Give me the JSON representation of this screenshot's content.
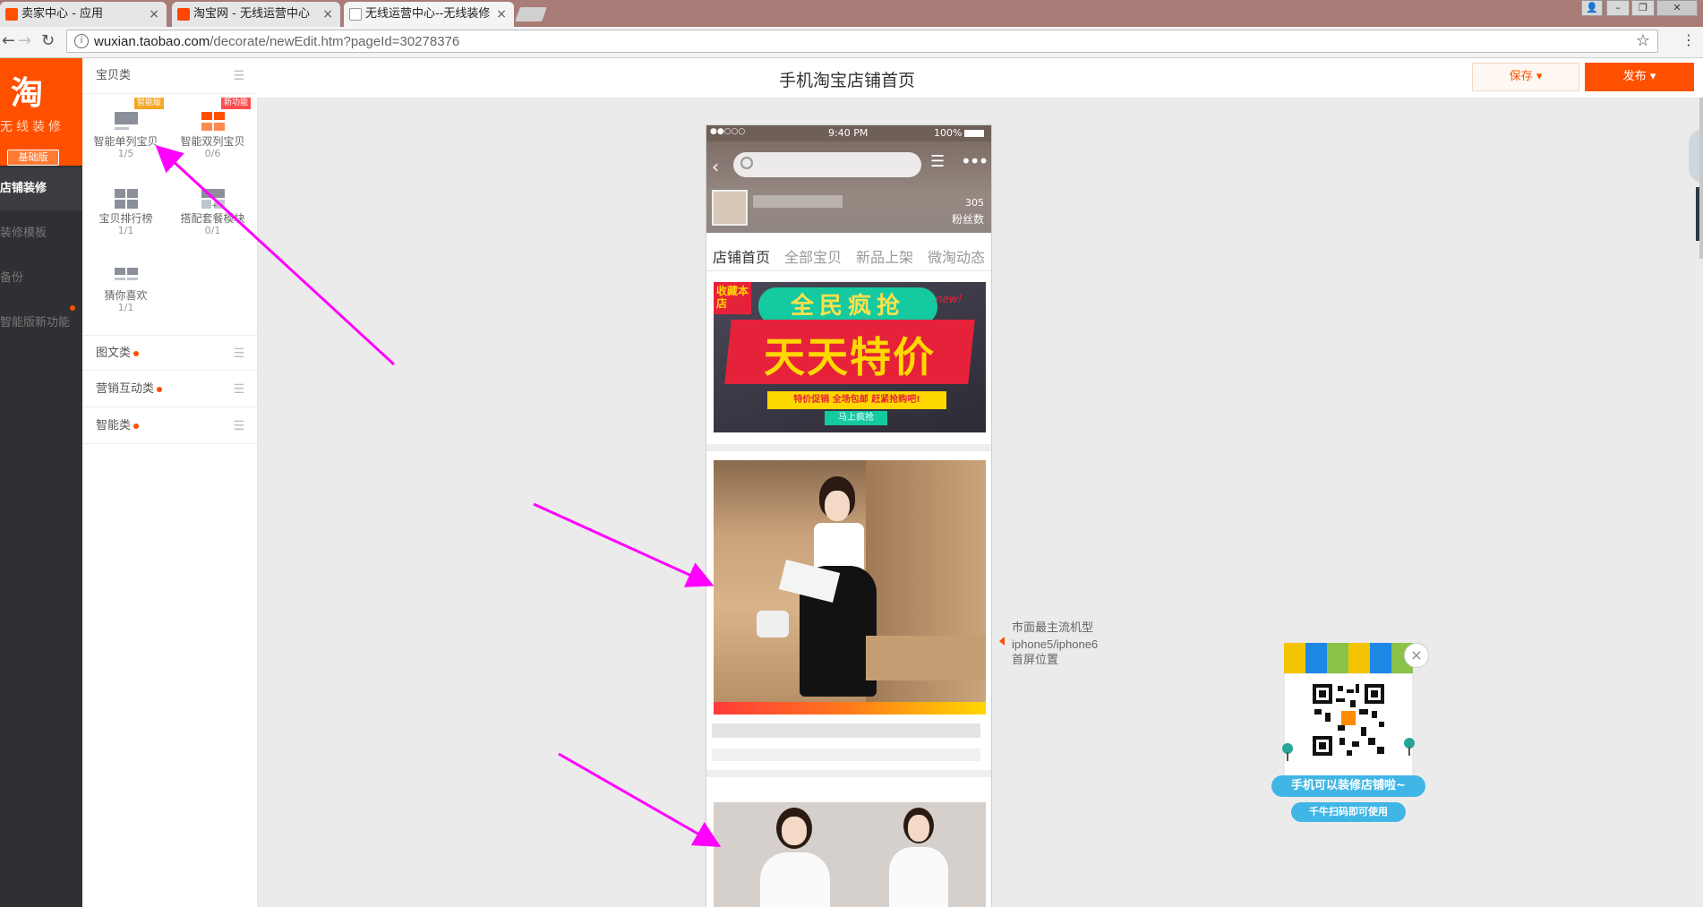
{
  "browser": {
    "tabs": [
      {
        "label": "卖家中心 - 应用",
        "favicon_color": "#ff5000"
      },
      {
        "label": "淘宝网 - 无线运营中心",
        "favicon_color": "#ff4400"
      },
      {
        "label": "无线运营中心--无线装修",
        "favicon_color": "#ffffff"
      }
    ],
    "url_host": "wuxian.taobao.com",
    "url_path": "/decorate/newEdit.htm?pageId=30278376"
  },
  "left_nav": {
    "logo_char": "淘",
    "logo_sub": "无线装修",
    "edition_badge": "基础版",
    "items": [
      "店铺装修",
      "装修模板",
      "备份",
      "智能版新功能"
    ]
  },
  "panel": {
    "sections": [
      {
        "label": "宝贝类"
      },
      {
        "label": "图文类"
      },
      {
        "label": "营销互动类"
      },
      {
        "label": "智能类"
      }
    ],
    "modules": [
      {
        "name": "智能单列宝贝",
        "count": "1/5",
        "tag": "智能版",
        "tag_color": "#f5a623"
      },
      {
        "name": "智能双列宝贝",
        "count": "0/6",
        "tag": "新功能",
        "tag_color": "#ff4d4f"
      },
      {
        "name": "宝贝排行榜",
        "count": "1/1"
      },
      {
        "name": "搭配套餐模块",
        "count": "0/1"
      },
      {
        "name": "猜你喜欢",
        "count": "1/1"
      }
    ]
  },
  "header": {
    "page_title": "手机淘宝店铺首页",
    "save_label": "保存",
    "publish_label": "发布"
  },
  "phone": {
    "signal": "●●○○○",
    "time": "9:40 PM",
    "battery": "100%",
    "fans_count": "305",
    "fans_label": "粉丝数",
    "tabs": [
      "店铺首页",
      "全部宝贝",
      "新品上架",
      "微淘动态"
    ],
    "banner": {
      "corner": "收藏本店",
      "line1": "全民疯抢",
      "line2": "天天特价",
      "line3": "特价促销 全场包邮 赶紧抢购吧!",
      "button": "马上疯抢",
      "new_tag": "new!"
    }
  },
  "screen_note": {
    "line1": "市面最主流机型",
    "line2": "iphone5/iphone6",
    "line3": "首屏位置"
  },
  "qr_popup": {
    "line1": "手机可以装修店铺啦~",
    "line2": "千牛扫码即可使用"
  },
  "colors": {
    "brand": "#ff5000",
    "annotation_arrow": "#ff00ff"
  }
}
